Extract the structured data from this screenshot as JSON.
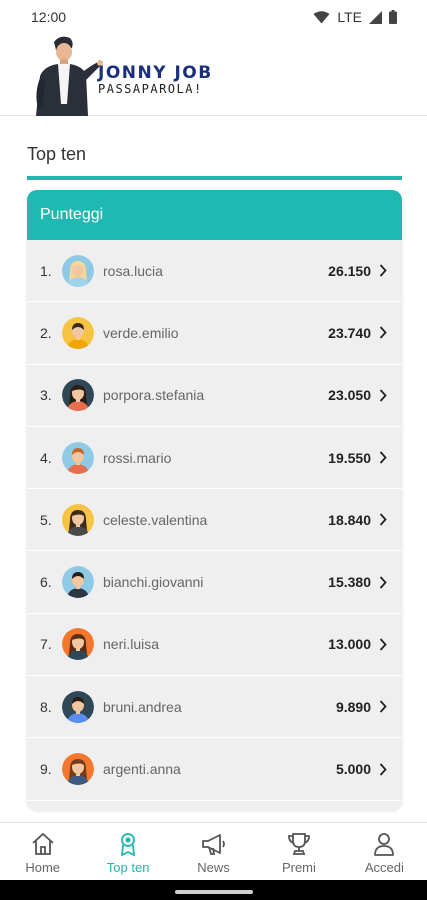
{
  "status_bar": {
    "time": "12:00",
    "network": "LTE"
  },
  "header": {
    "logo_title": "JONNY JOB",
    "logo_subtitle": "PASSAPAROLA!"
  },
  "page": {
    "title": "Top ten"
  },
  "leaderboard": {
    "header": "Punteggi",
    "rows": [
      {
        "rank": "1.",
        "name": "rosa.lucia",
        "score": "26.150",
        "avatar": "woman-light-hair"
      },
      {
        "rank": "2.",
        "name": "verde.emilio",
        "score": "23.740",
        "avatar": "man-yellow"
      },
      {
        "rank": "3.",
        "name": "porpora.stefania",
        "score": "23.050",
        "avatar": "woman-dark-hair"
      },
      {
        "rank": "4.",
        "name": "rossi.mario",
        "score": "19.550",
        "avatar": "man-orange-shirt"
      },
      {
        "rank": "5.",
        "name": "celeste.valentina",
        "score": "18.840",
        "avatar": "woman-yellow"
      },
      {
        "rank": "6.",
        "name": "bianchi.giovanni",
        "score": "15.380",
        "avatar": "man-suit"
      },
      {
        "rank": "7.",
        "name": "neri.luisa",
        "score": "13.000",
        "avatar": "woman-orange"
      },
      {
        "rank": "8.",
        "name": "bruni.andrea",
        "score": "9.890",
        "avatar": "man-dark-hair"
      },
      {
        "rank": "9.",
        "name": "argenti.anna",
        "score": "5.000",
        "avatar": "woman-orange-2"
      }
    ]
  },
  "bottom_nav": {
    "items": [
      {
        "label": "Home",
        "icon": "home-icon",
        "active": false
      },
      {
        "label": "Top ten",
        "icon": "award-icon",
        "active": true
      },
      {
        "label": "News",
        "icon": "megaphone-icon",
        "active": false
      },
      {
        "label": "Premi",
        "icon": "trophy-icon",
        "active": false
      },
      {
        "label": "Accedi",
        "icon": "user-icon",
        "active": false
      }
    ]
  },
  "colors": {
    "accent": "#20b5ad",
    "brand": "#1c2f7a"
  }
}
